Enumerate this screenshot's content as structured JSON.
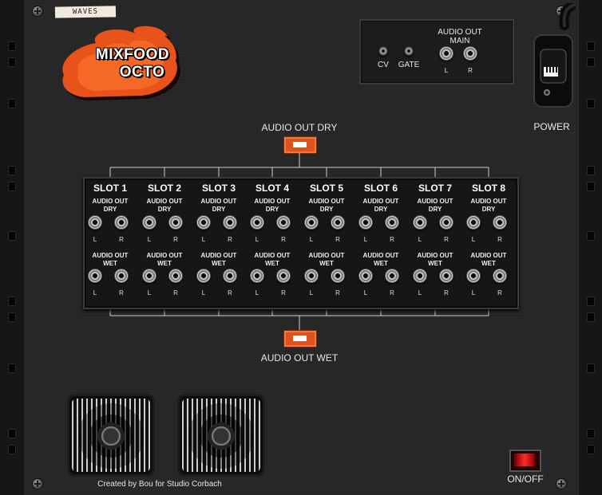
{
  "device": {
    "tape_label": "WAVES",
    "logo_line1": "MIXFOOD",
    "logo_line2": "OCTO"
  },
  "top_io": {
    "cv_label": "CV",
    "gate_label": "GATE",
    "main_title_line1": "AUDIO OUT",
    "main_title_line2": "MAIN",
    "left_label": "L",
    "right_label": "R"
  },
  "power": {
    "label": "POWER"
  },
  "bus": {
    "dry_label": "AUDIO OUT DRY",
    "wet_label": "AUDIO OUT WET"
  },
  "slots": [
    {
      "name": "SLOT 1"
    },
    {
      "name": "SLOT 2"
    },
    {
      "name": "SLOT 3"
    },
    {
      "name": "SLOT 4"
    },
    {
      "name": "SLOT 5"
    },
    {
      "name": "SLOT 6"
    },
    {
      "name": "SLOT 7"
    },
    {
      "name": "SLOT 8"
    }
  ],
  "slot_labels": {
    "dry_line1": "AUDIO OUT",
    "dry_line2": "DRY",
    "wet_line1": "AUDIO OUT",
    "wet_line2": "WET",
    "left": "L",
    "right": "R"
  },
  "footer": {
    "credit": "Created by Bou for Studio Corbach",
    "onoff_label": "ON/OFF"
  },
  "colors": {
    "accent_orange": "#e0521c",
    "switch_red": "#ff2a2a"
  },
  "icons": {
    "power_plug": "power-plug-icon",
    "fan": "fan-icon",
    "flame": "flame-logo-icon"
  }
}
